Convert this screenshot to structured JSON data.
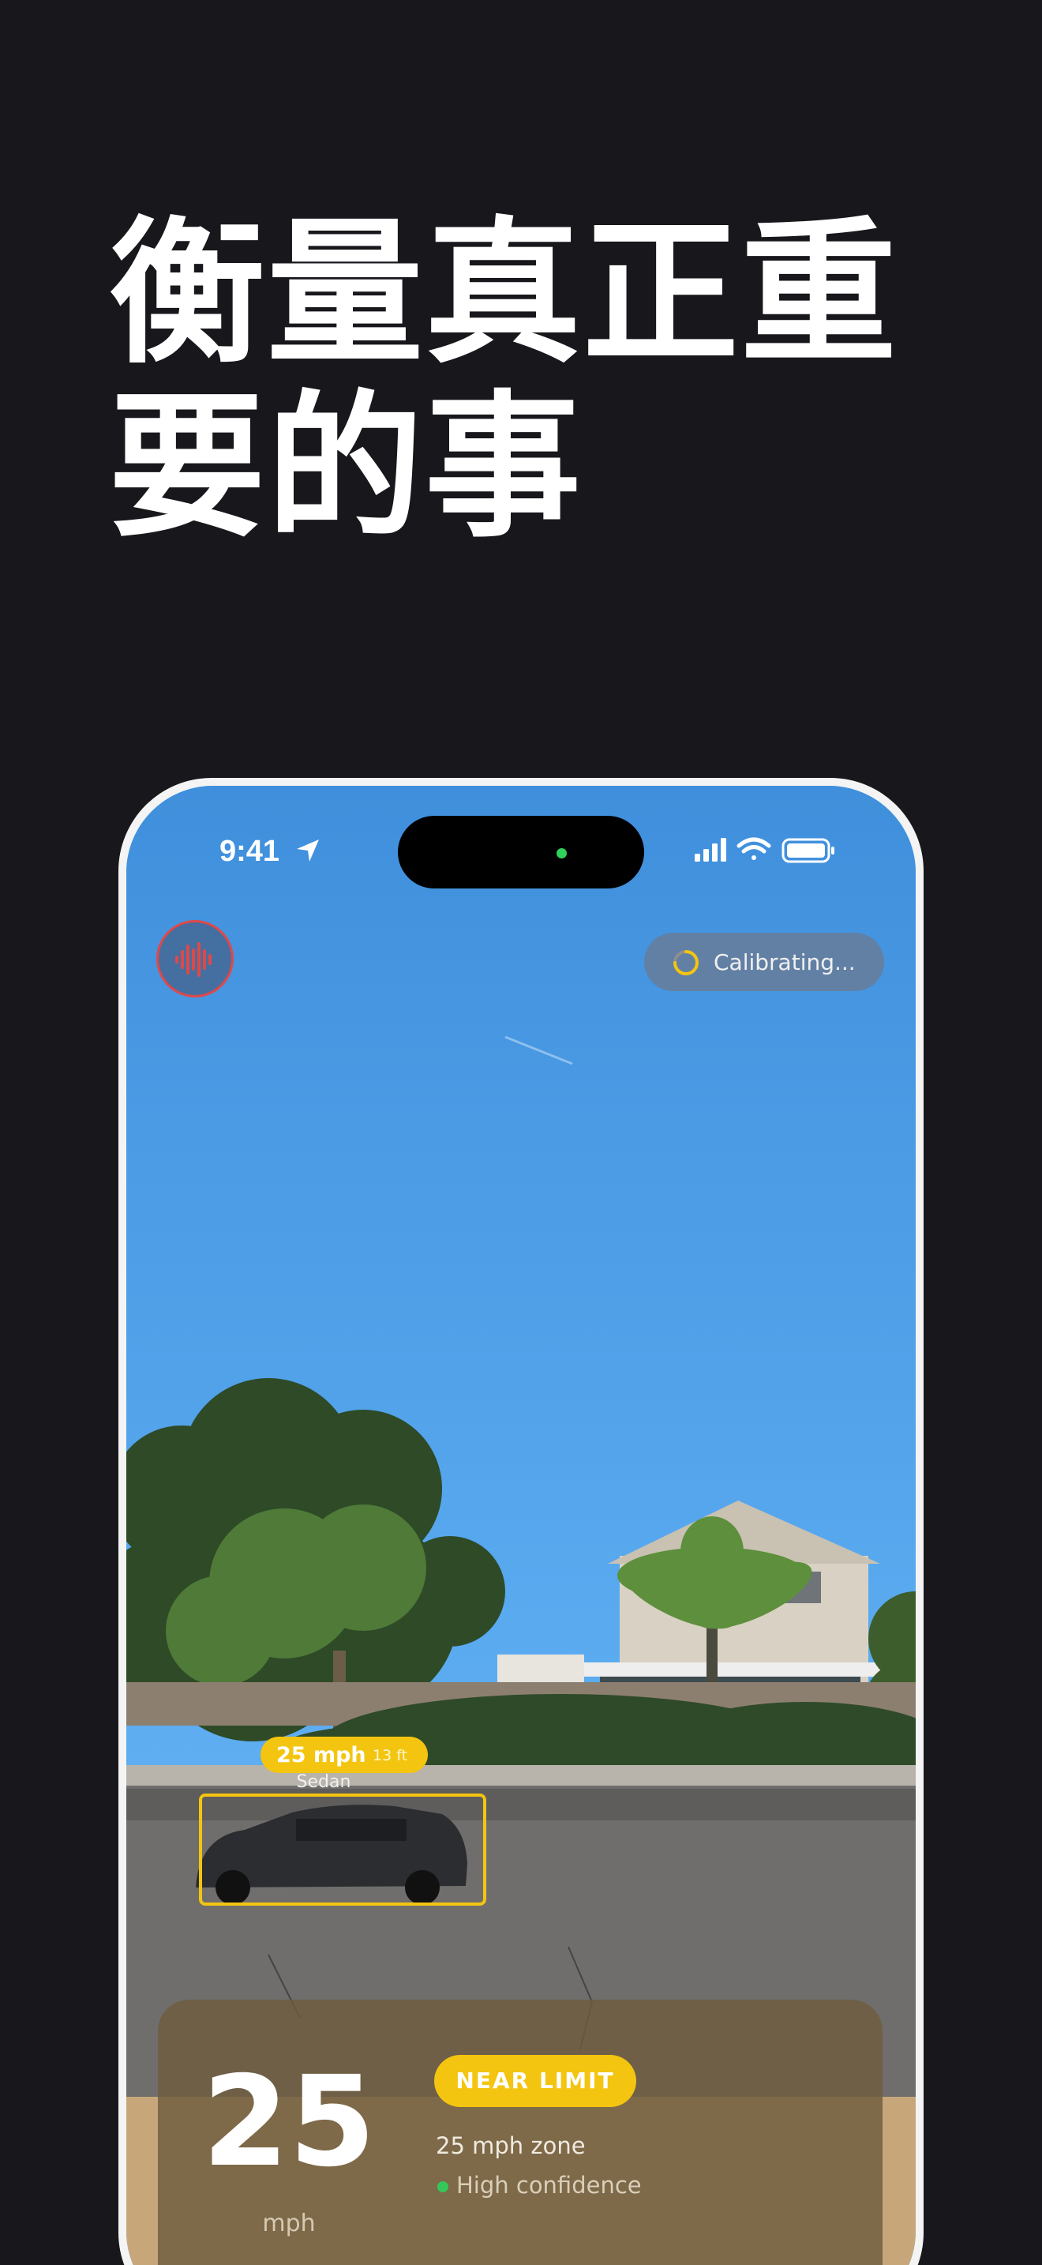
{
  "headline": {
    "line1": "衡量真正重",
    "line2": "要的事"
  },
  "status_bar": {
    "time": "9:41",
    "icons": [
      "location-arrow-icon",
      "cellular-signal-icon",
      "wifi-icon",
      "battery-icon"
    ]
  },
  "controls": {
    "mic_icon": "audio-waveform-icon",
    "calibration": {
      "icon": "spinner-icon",
      "label": "Calibrating..."
    }
  },
  "detection": {
    "speed": "25 mph",
    "distance": "13 ft",
    "vehicle_type": "Sedan"
  },
  "info_card": {
    "speed_value": "25",
    "speed_unit": "mph",
    "badge": "NEAR LIMIT",
    "zone": "25 mph zone",
    "confidence": "High confidence"
  },
  "colors": {
    "background": "#18171c",
    "accent_yellow": "#f3c510",
    "mic_red": "#e04848",
    "confidence_green": "#34c759"
  }
}
